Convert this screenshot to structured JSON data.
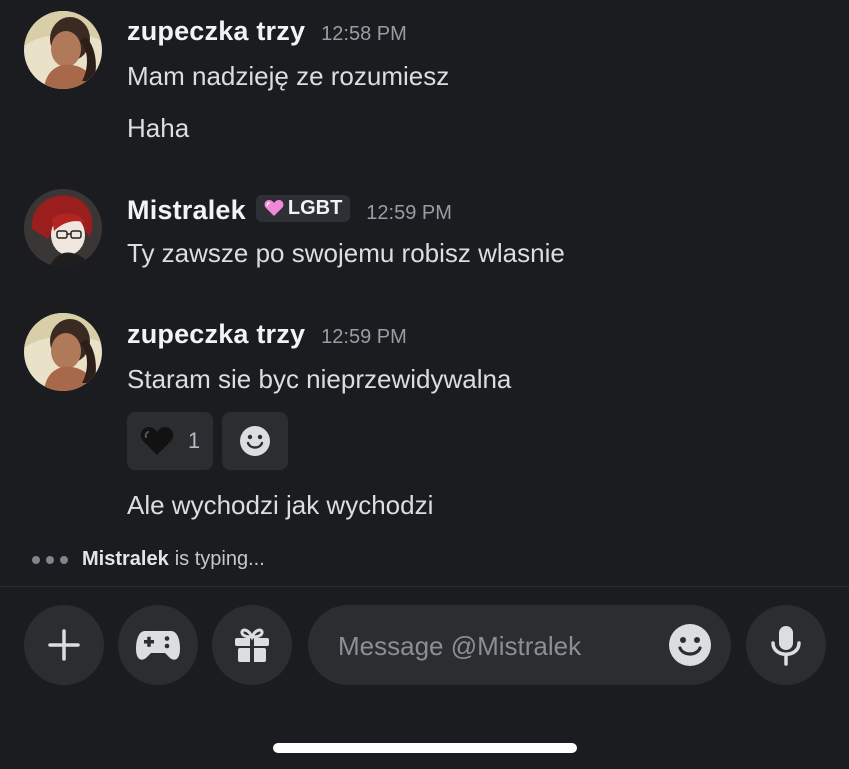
{
  "messages": [
    {
      "author": "zupeczka trzy",
      "timestamp": "12:58 PM",
      "lines": [
        "Mam nadzieję ze rozumiesz",
        "Haha"
      ]
    },
    {
      "author": "Mistralek",
      "tag": {
        "icon": "pink-heart-icon",
        "label": "LGBT"
      },
      "timestamp": "12:59 PM",
      "lines": [
        "Ty zawsze po swojemu robisz wlasnie"
      ]
    },
    {
      "author": "zupeczka trzy",
      "timestamp": "12:59 PM",
      "lines": [
        "Staram sie byc nieprzewidywalna"
      ],
      "reactions": [
        {
          "icon": "black-heart-icon",
          "count": "1"
        }
      ],
      "after_reactions": [
        "Ale wychodzi jak wychodzi"
      ]
    }
  ],
  "typing": {
    "user": "Mistralek",
    "text": "is typing..."
  },
  "composer": {
    "placeholder": "Message @Mistralek",
    "buttons": [
      "plus-icon",
      "gamepad-icon",
      "gift-icon",
      "emoji-icon",
      "microphone-icon"
    ]
  },
  "colors": {
    "background": "#1b1c20",
    "surface": "#2b2d31",
    "username": "#f2f3f5",
    "timestamp": "#9a9ca3"
  }
}
